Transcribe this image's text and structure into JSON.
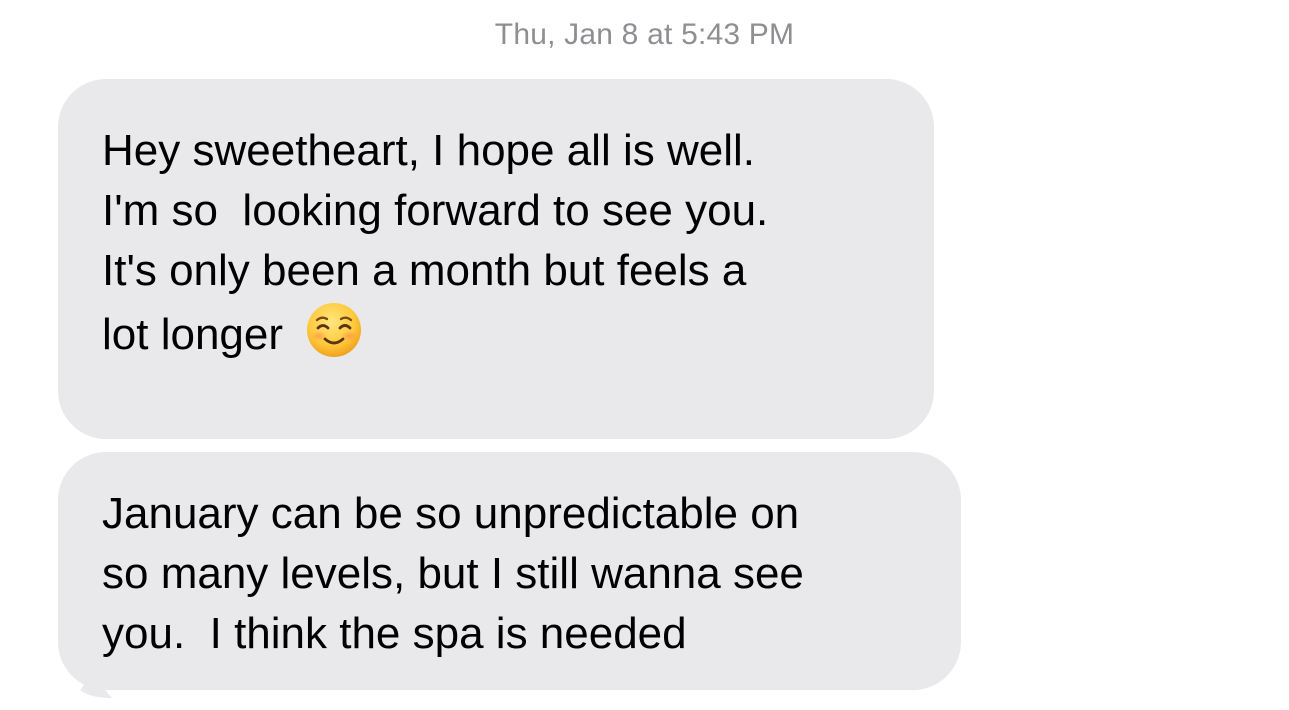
{
  "header": {
    "timestamp_day": "Thu, Jan 8",
    "timestamp_at": "at",
    "timestamp_time": "5:43 PM"
  },
  "messages": [
    {
      "lines": [
        "Hey sweetheart, I hope all is well.",
        "I'm so  looking forward to see you.",
        "It's only been a month but feels a",
        "lot longer"
      ],
      "emoji": "smiling-face-with-blush-icon"
    },
    {
      "lines": [
        "January can be so unpredictable on",
        "so many levels, but I still wanna see",
        "you.  I think the spa is needed"
      ]
    }
  ],
  "colors": {
    "incoming_bubble": "#e9e9eb",
    "timestamp_text": "#8e8e93",
    "message_text": "#000000",
    "background": "#ffffff"
  }
}
